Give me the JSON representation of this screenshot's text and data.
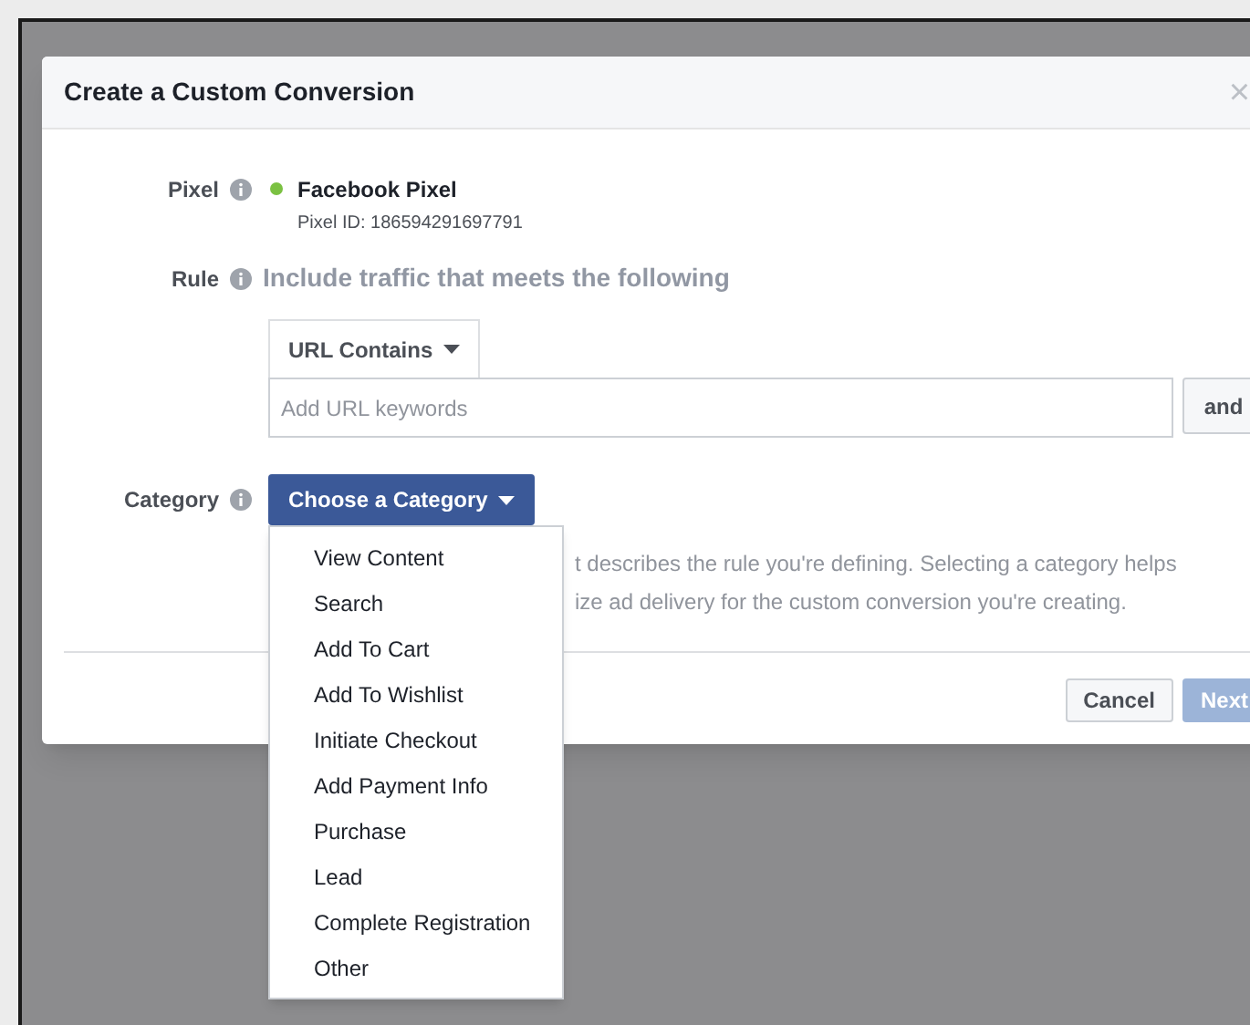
{
  "dialog": {
    "title": "Create a Custom Conversion",
    "close": "×",
    "pixel": {
      "label": "Pixel",
      "name": "Facebook Pixel",
      "id": "Pixel ID: 186594291697791",
      "active": true
    },
    "rule": {
      "label": "Rule",
      "heading": "Include traffic that meets the following",
      "operator": "URL Contains",
      "placeholder": "Add URL keywords",
      "and_button": "and"
    },
    "category": {
      "label": "Category",
      "button": "Choose a Category",
      "help_lines": [
        "t describes the rule you're defining. Selecting a category helps",
        "ize ad delivery for the custom conversion you're creating."
      ],
      "menu": [
        {
          "label": "View Content"
        },
        {
          "label": "Search"
        },
        {
          "label": "Add To Cart"
        },
        {
          "label": "Add To Wishlist"
        },
        {
          "label": "Initiate Checkout"
        },
        {
          "label": "Add Payment Info"
        },
        {
          "label": "Purchase"
        },
        {
          "label": "Lead"
        },
        {
          "label": "Complete Registration"
        },
        {
          "label": "Other"
        }
      ]
    },
    "buttons": [
      {
        "label": "Cancel",
        "disabled": false
      },
      {
        "label": "Next",
        "disabled": true
      }
    ]
  }
}
